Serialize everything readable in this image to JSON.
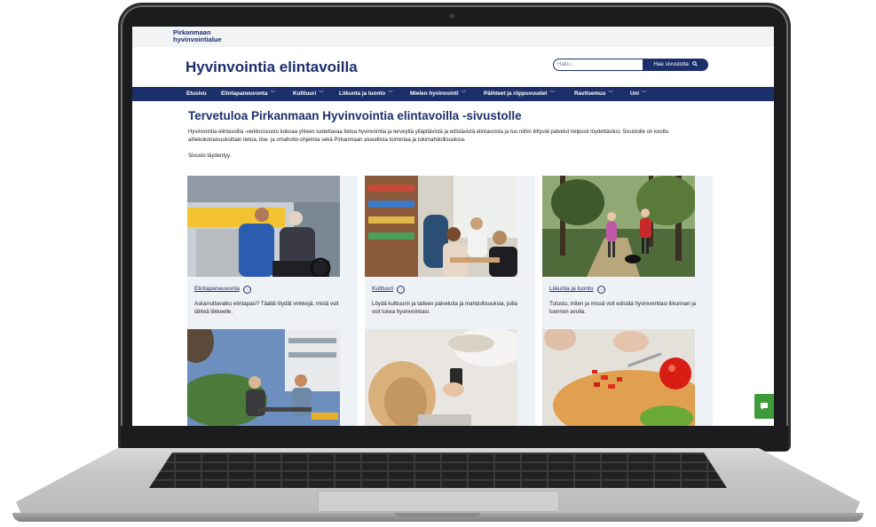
{
  "header": {
    "org_logo_line1": "Pirkanmaan",
    "org_logo_line2": "hyvinvointialue",
    "site_title": "Hyvinvointia elintavoilla",
    "search_placeholder": "Haku...",
    "search_button": "Hae sivustolta"
  },
  "nav": {
    "items": [
      {
        "label": "Etusivu"
      },
      {
        "label": "Elintapaneuvonta"
      },
      {
        "label": "Kulttuuri"
      },
      {
        "label": "Liikunta ja luonto"
      },
      {
        "label": "Mielen hyvinvointi"
      },
      {
        "label": "Päihteet ja riippuvuudet"
      },
      {
        "label": "Ravitsemus"
      },
      {
        "label": "Uni"
      }
    ]
  },
  "main": {
    "title": "Tervetuloa Pirkanmaan Hyvinvointia elintavoilla -sivustolle",
    "intro": "Hyvinvointia elintavoilla -verkkosivusto kokoaa yhteen luotettavaa tietoa hyvinvointia ja terveyttä ylläpitävistä ja edistävistä elintavoista ja tuo niihin liittyvät palvelut helposti löydettäviksi. Sivustolle on koottu aihekokonaisuuksittain tietoa, itse- ja omahoito-ohjelmia sekä Pirkanmaan alueellista toimintaa ja tukimahdollisuuksia.",
    "note": "Sivusto täydentyy.",
    "cards": [
      {
        "link": "Elintapaneuvonta",
        "text": "Askarruttavatko elintapasi? Täältä löydät vinkkejä, mistä voit lähteä liikkeelle."
      },
      {
        "link": "Kulttuuri",
        "text": "Löydä kulttuurin ja taiteen palveluita ja mahdollisuuksia, joilla voit tukea hyvinvointiasi."
      },
      {
        "link": "Liikunta ja luonto",
        "text": "Tutustu, miten ja missä voit edistää hyvinvointiasi liikunnan ja luonnon avulla."
      }
    ]
  },
  "colors": {
    "brand": "#1b2f6b",
    "feedback": "#3e9a3a",
    "card_bg": "#eef1f5"
  },
  "icons": {
    "search": "search-icon",
    "chevron": "chevron-down-icon",
    "card_arrow": "arrow-right-circle-icon",
    "feedback": "chat-icon"
  }
}
